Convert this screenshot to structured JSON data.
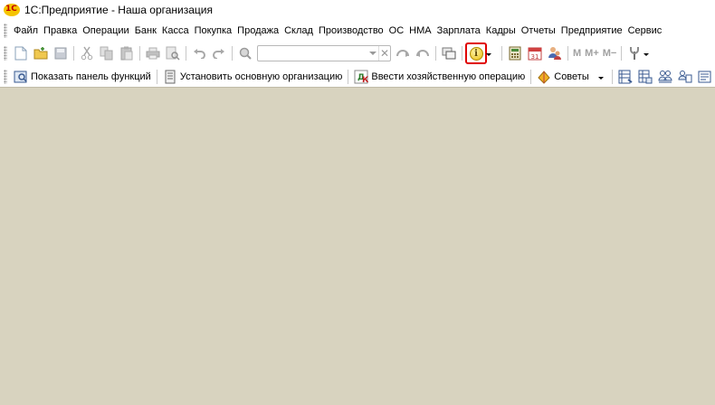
{
  "window": {
    "title": "1С:Предприятие - Наша организация",
    "logo_text": "1С"
  },
  "menu": [
    "Файл",
    "Правка",
    "Операции",
    "Банк",
    "Касса",
    "Покупка",
    "Продажа",
    "Склад",
    "Производство",
    "ОС",
    "НМА",
    "Зарплата",
    "Кадры",
    "Отчеты",
    "Предприятие",
    "Сервис"
  ],
  "toolbar": {
    "memory_buttons": [
      "M",
      "M+",
      "M−"
    ],
    "calendar_day": "31",
    "info_glyph": "i"
  },
  "functions_bar": {
    "show_panel": "Показать панель функций",
    "set_org": "Установить основную организацию",
    "enter_operation": "Ввести хозяйственную операцию",
    "tips": "Советы"
  },
  "colors": {
    "workspace": "#d8d3bf",
    "highlight": "#e00000"
  }
}
